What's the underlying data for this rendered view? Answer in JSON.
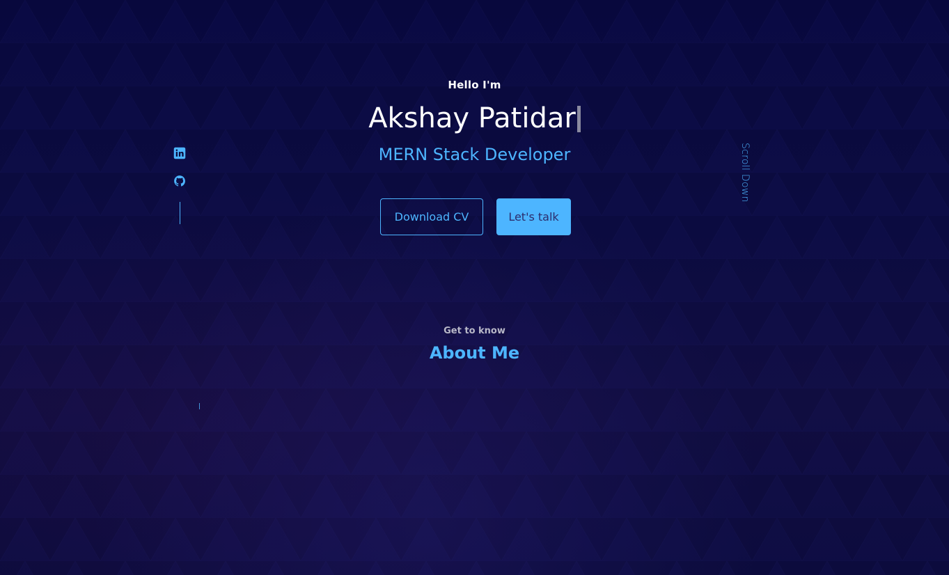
{
  "hero": {
    "greeting": "Hello I'm",
    "name": "Akshay Patidar",
    "role": "MERN Stack Developer",
    "buttons": {
      "download_cv": "Download CV",
      "lets_talk": "Let's talk"
    },
    "scroll_down": "Scroll Down"
  },
  "socials": [
    {
      "icon": "linkedin-icon"
    },
    {
      "icon": "github-icon"
    }
  ],
  "about": {
    "subtitle": "Get to know",
    "title": "About Me"
  },
  "colors": {
    "accent": "#4db5ff",
    "background": "#0a0a3a",
    "button_text_dark": "#2c2c6c",
    "white": "#ffffff"
  }
}
